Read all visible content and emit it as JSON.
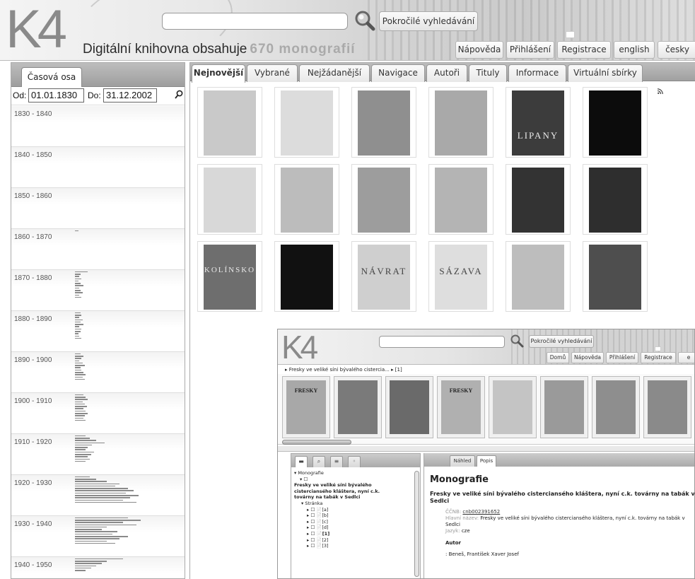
{
  "header": {
    "logo": "K4",
    "tagline": "Digitální knihovna obsahuje",
    "count_label": "670 monografií",
    "advanced_search_label": "Pokročilé vyhledávání",
    "nav": [
      "Nápověda",
      "Přihlášení",
      "Registrace",
      "english",
      "česky"
    ]
  },
  "timeline": {
    "tab_label": "Časová osa",
    "from_label": "Od:",
    "from_value": "01.01.1830",
    "to_label": "Do:",
    "to_value": "31.12.2002",
    "decades": [
      {
        "label": "1830 - 1840",
        "bars": []
      },
      {
        "label": "1840 - 1850",
        "bars": []
      },
      {
        "label": "1850 - 1860",
        "bars": []
      },
      {
        "label": "1860 - 1870",
        "bars": [
          0.03
        ]
      },
      {
        "label": "1870 - 1880",
        "bars": [
          0.12,
          0.05,
          0.04,
          0.06,
          0.03,
          0.05,
          0.08,
          0.04,
          0.05,
          0.07,
          0.04,
          0.06
        ]
      },
      {
        "label": "1880 - 1890",
        "bars": [
          0.05,
          0.06,
          0.04,
          0.07,
          0.05,
          0.08,
          0.04,
          0.06,
          0.05,
          0.03,
          0.04,
          0.06
        ]
      },
      {
        "label": "1890 - 1900",
        "bars": [
          0.05,
          0.08,
          0.06,
          0.04,
          0.07,
          0.09,
          0.05,
          0.06,
          0.08,
          0.1,
          0.07,
          0.09
        ]
      },
      {
        "label": "1900 - 1910",
        "bars": [
          0.08,
          0.1,
          0.12,
          0.07,
          0.09,
          0.11,
          0.08,
          0.1,
          0.12,
          0.09,
          0.08,
          0.1
        ]
      },
      {
        "label": "1910 - 1920",
        "bars": [
          0.1,
          0.14,
          0.2,
          0.28,
          0.16,
          0.12,
          0.1,
          0.18,
          0.15,
          0.12,
          0.14,
          0.1
        ]
      },
      {
        "label": "1920 - 1930",
        "bars": [
          0.14,
          0.2,
          0.3,
          0.42,
          0.38,
          0.5,
          0.55,
          0.48,
          0.6,
          0.52,
          0.45,
          0.58
        ]
      },
      {
        "label": "1930 - 1940",
        "bars": [
          0.5,
          0.62,
          0.45,
          0.58,
          0.3,
          0.25,
          0.4,
          0.35,
          0.5,
          0.42,
          0.3,
          0.38
        ]
      },
      {
        "label": "1940 - 1950",
        "bars": [
          0.45,
          0.3,
          0.25,
          0.2,
          0.15,
          0.1
        ]
      }
    ]
  },
  "main": {
    "tabs": [
      "Nejnovější",
      "Vybrané",
      "Nejžádanější",
      "Navigace",
      "Autoři",
      "Tituly",
      "Informace",
      "Virtuální sbírky"
    ],
    "active_tab": "Nejnovější",
    "covers": [
      {
        "shade": "#c9c9c9",
        "text": ""
      },
      {
        "shade": "#dcdcdc",
        "text": ""
      },
      {
        "shade": "#8f8f8f",
        "text": ""
      },
      {
        "shade": "#a9a9a9",
        "text": ""
      },
      {
        "shade": "#3c3c3c",
        "text": "LIPANY"
      },
      {
        "shade": "#0c0c0c",
        "text": ""
      },
      {
        "shade": "#d8d8d8",
        "text": ""
      },
      {
        "shade": "#bcbcbc",
        "text": ""
      },
      {
        "shade": "#9d9d9d",
        "text": ""
      },
      {
        "shade": "#b4b4b4",
        "text": ""
      },
      {
        "shade": "#333333",
        "text": ""
      },
      {
        "shade": "#2e2e2e",
        "text": ""
      },
      {
        "shade": "#6e6e6e",
        "text": "KOLÍNSKO"
      },
      {
        "shade": "#111111",
        "text": ""
      },
      {
        "shade": "#cfcfcf",
        "text": "NÁVRAT"
      },
      {
        "shade": "#dedede",
        "text": "SÁZAVA"
      },
      {
        "shade": "#bdbdbd",
        "text": ""
      },
      {
        "shade": "#4e4e4e",
        "text": ""
      }
    ]
  },
  "inset": {
    "logo": "K4",
    "advanced_search_label": "Pokročilé vyhledávání",
    "nav": [
      "Domů",
      "Nápověda",
      "Přihlášení",
      "Registrace",
      "e"
    ],
    "breadcrumb": "▸ Fresky ve veliké síni bývalého cistercia... ▸ [1]",
    "pages": [
      {
        "shade": "#a8a8a8",
        "text": "FRESKY"
      },
      {
        "shade": "#7a7a7a",
        "text": ""
      },
      {
        "shade": "#6a6a6a",
        "text": ""
      },
      {
        "shade": "#b0b0b0",
        "text": "FRESKY"
      },
      {
        "shade": "#c4c4c4",
        "text": ""
      },
      {
        "shade": "#9a9a9a",
        "text": ""
      },
      {
        "shade": "#8e8e8e",
        "text": ""
      },
      {
        "shade": "#8a8a8a",
        "text": ""
      }
    ],
    "tree": {
      "root": "▾ Monografie",
      "node": "▾ ☐",
      "title": "Fresky ve veliké síni bývalého cisterciansého kláštera, nyní c.k. továrny na tabák v Sedlci",
      "pages_label": "▾ Stránka",
      "pages": [
        "▸ ☐ 📄[a]",
        "▸ ☐ 📄[b]",
        "▸ ☐ 📄[c]",
        "▸ ☐ 📄[d]",
        "▸ ☐ 📄[1]",
        "▸ ☐ 📄[2]",
        "▸ ☐ 📄[3]"
      ]
    },
    "detail_tabs": [
      "Náhled",
      "Popis"
    ],
    "detail": {
      "heading": "Monografie",
      "title": "Fresky ve veliké síni bývalého cisterciansého kláštera, nyní c.k. továrny na tabák v Sedlci",
      "ccnb_key": "ČČNB:",
      "ccnb_value": "cnb002391652",
      "main_title_key": "Hlavní název:",
      "main_title_value": "Fresky ve veliké síni bývalého cisterciansého kláštera, nyní c.k. továrny na tabák v Sedlci",
      "lang_key": "Jazyk:",
      "lang_value": "cze",
      "author_heading": "Autor",
      "author": ": Beneš, František Xaver Josef"
    }
  }
}
